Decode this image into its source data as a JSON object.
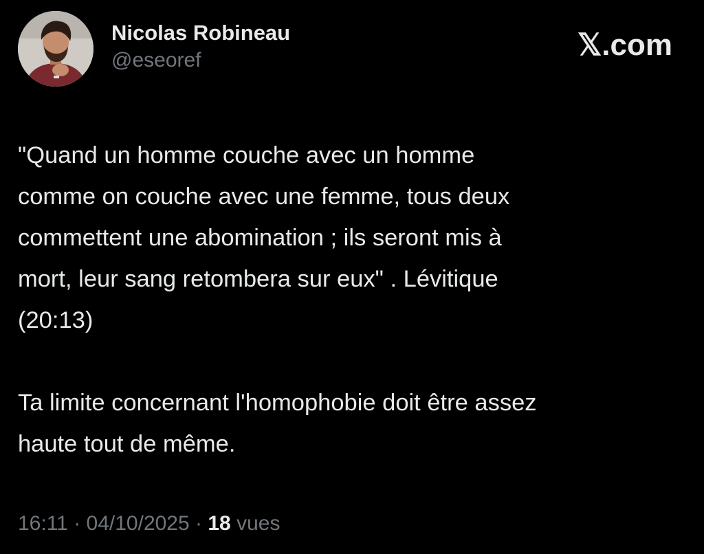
{
  "author": {
    "display_name": "Nicolas Robineau",
    "handle": "@eseoref",
    "avatar_icon": "profile-photo"
  },
  "brand": {
    "logo_text": "𝕏.com"
  },
  "tweet": {
    "paragraphs": [
      "\"Quand un homme couche avec un homme\ncomme on couche avec une femme, tous deux\ncommettent une abomination ; ils seront mis à\nmort, leur sang retombera sur eux\" . Lévitique\n(20:13)",
      "Ta limite concernant l'homophobie doit être assez\nhaute tout de même."
    ]
  },
  "meta": {
    "time": "16:11",
    "separator": " · ",
    "date": "04/10/2025",
    "views_count": "18",
    "views_label": " vues"
  },
  "colors": {
    "background": "#000000",
    "primary_text": "#e7e9ea",
    "secondary_text": "#71767b"
  }
}
